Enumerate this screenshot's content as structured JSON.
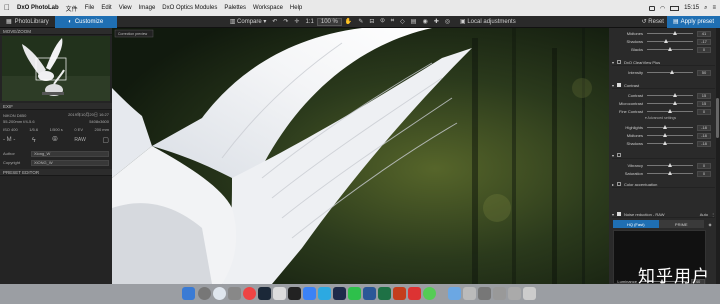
{
  "menubar": {
    "app_name": "DxO PhotoLab",
    "items": [
      "文件",
      "File",
      "Edit",
      "View",
      "Image",
      "DxO Optics Modules",
      "Palettes",
      "Workspace",
      "Help"
    ],
    "time": "15:15"
  },
  "toolbar": {
    "tab_library": "PhotoLibrary",
    "tab_customize": "Customize",
    "compare": "Compare",
    "zoom": "100 %",
    "local_adjustments": "Local adjustments",
    "reset": "Reset",
    "apply_preset": "Apply preset"
  },
  "left_panel": {
    "move_zoom_title": "MOVE/ZOOM",
    "exif_title": "EXIF",
    "camera": "NIKON D850",
    "date": "2019年10月20日 16:27",
    "lens": "55-200mm f/4-5.6",
    "dimensions": "5408x3600",
    "exposure": [
      "ISO 400",
      "1/5.6",
      "1/500 s",
      "0 EV",
      "200 mm"
    ],
    "mode": "M",
    "format": "RAW",
    "author_label": "Author",
    "author_value": "Xiong_W",
    "copyright_label": "Copyright",
    "copyright_value": "XiONG_W",
    "preset_editor": "PRESET EDITOR"
  },
  "viewer": {
    "badge": "Correction preview"
  },
  "right_panel": {
    "top_sliders": [
      {
        "label": "Midtones",
        "value": "41",
        "pos": 0.6
      },
      {
        "label": "Shadows",
        "value": "-17",
        "pos": 0.42
      },
      {
        "label": "Blacks",
        "value": "0",
        "pos": 0.5
      }
    ],
    "clearview": {
      "title": "DxO ClearView Plus",
      "label": "Intensity",
      "value": "50",
      "pos": 0.55
    },
    "contrast": {
      "title": "Contrast",
      "sliders": [
        {
          "label": "Contrast",
          "value": "15",
          "pos": 0.6
        },
        {
          "label": "Microcontrast",
          "value": "15",
          "pos": 0.6
        },
        {
          "label": "Fine Contrast",
          "value": "0",
          "pos": 0.5
        }
      ],
      "advanced": "Advanced settings",
      "adv_sliders": [
        {
          "label": "Highlights",
          "value": "-18",
          "pos": 0.4
        },
        {
          "label": "Midtones",
          "value": "-18",
          "pos": 0.4
        },
        {
          "label": "Shadows",
          "value": "-18",
          "pos": 0.4
        }
      ]
    },
    "color": {
      "sliders": [
        {
          "label": "Vibrancy",
          "value": "0",
          "pos": 0.5
        },
        {
          "label": "Saturation",
          "value": "0",
          "pos": 0.5
        }
      ],
      "color_accent": "Color accentuation"
    },
    "noise": {
      "title": "Noise reduction - RAW",
      "auto": "Auto",
      "hq": "HQ (Fast)",
      "prime": "PRIME",
      "luminance_label": "Luminance",
      "luminance_value": "40",
      "luminance_pos": 0.45
    }
  },
  "watermark": "知乎用户",
  "colors": {
    "accent": "#1f6fb3"
  }
}
